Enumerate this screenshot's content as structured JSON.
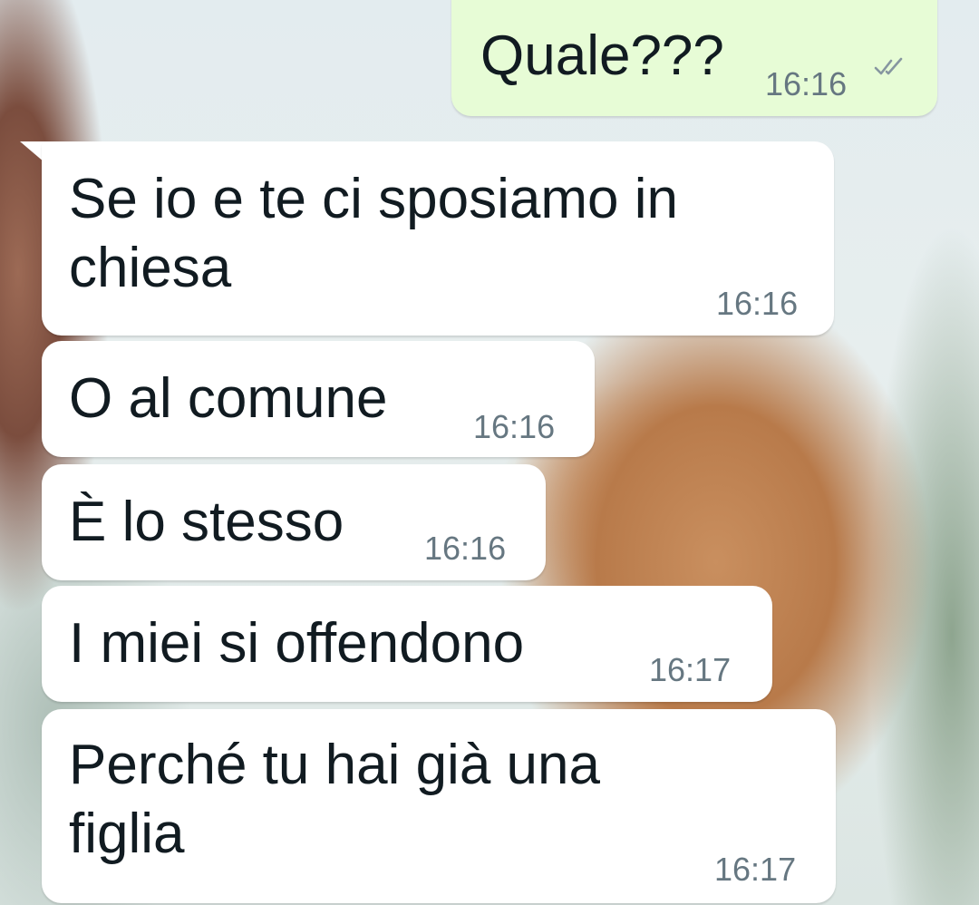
{
  "chat": {
    "messages": [
      {
        "direction": "outgoing",
        "text": "Quale???",
        "time": "16:16",
        "status_icon": "double-check-icon"
      },
      {
        "direction": "incoming",
        "text_lines": [
          "Se io e te ci sposiamo in",
          "chiesa"
        ],
        "time": "16:16"
      },
      {
        "direction": "incoming",
        "text": "O al comune",
        "time": "16:16"
      },
      {
        "direction": "incoming",
        "text": "È lo stesso",
        "time": "16:16"
      },
      {
        "direction": "incoming",
        "text": "I miei si offendono",
        "time": "16:17"
      },
      {
        "direction": "incoming",
        "text_lines": [
          "Perché tu hai già una",
          "figlia"
        ],
        "time": "16:17"
      }
    ]
  },
  "colors": {
    "incoming_bubble": "#ffffff",
    "outgoing_bubble": "#e7fcd6",
    "text": "#111b21",
    "timestamp": "#667781"
  }
}
